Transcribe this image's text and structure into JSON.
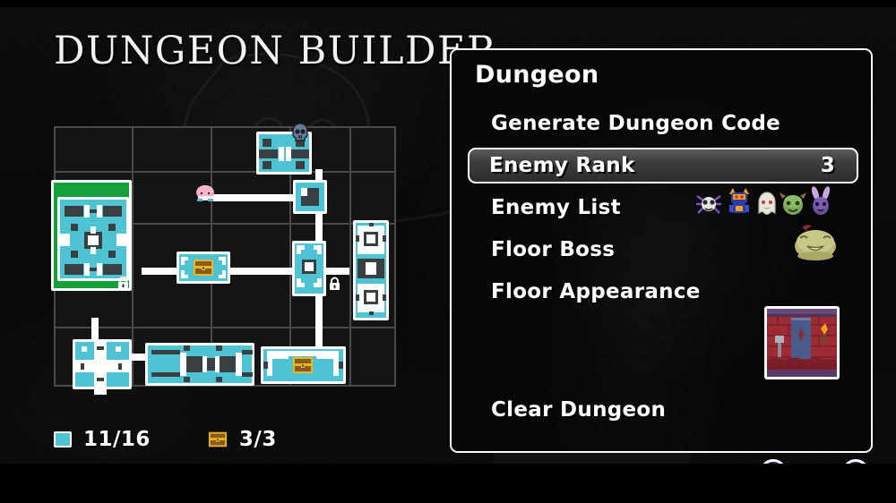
{
  "screen": {
    "title": "DUNGEON BUILDER"
  },
  "map": {
    "columns": 5,
    "rows": 5,
    "status": {
      "rooms_icon": "room-square-icon",
      "rooms_count": "11/16",
      "chest_icon": "treasure-chest-icon",
      "chest_count": "3/3"
    },
    "markers": {
      "boss_icon": "skull-icon",
      "hero_icon": "hero-sprite",
      "lock_icon": "lock-icon"
    }
  },
  "panel": {
    "title": "Dungeon",
    "items": [
      {
        "label": "Generate Dungeon Code",
        "value": "",
        "selected": false
      },
      {
        "label": "Enemy Rank",
        "value": "3",
        "selected": true
      },
      {
        "label": "Enemy List",
        "value": "",
        "selected": false
      },
      {
        "label": "Floor Boss",
        "value": "",
        "selected": false
      },
      {
        "label": "Floor Appearance",
        "value": "",
        "selected": false
      },
      {
        "label": "Clear Dungeon",
        "value": "",
        "selected": false
      }
    ],
    "enemy_list": [
      {
        "name": "spider-enemy-sprite",
        "body": "#d8d8d8",
        "accent": "#8d5fd6"
      },
      {
        "name": "armored-knight-enemy-sprite",
        "body": "#f0a024",
        "accent": "#2a3ea8"
      },
      {
        "name": "ghost-enemy-sprite",
        "body": "#e8e6dc",
        "accent": "#c04040"
      },
      {
        "name": "green-beast-enemy-sprite",
        "body": "#7aa85a",
        "accent": "#a06a3a"
      },
      {
        "name": "bat-enemy-sprite",
        "body": "#6a4f9e",
        "accent": "#c9a6e0"
      }
    ],
    "floor_boss": {
      "name": "slime-boss-sprite",
      "body": "#b8b878",
      "accent": "#8e2a3a"
    },
    "floor_appearance": {
      "name": "red-brick-room-preview",
      "wall": "#9e2b33",
      "banner": "#4a5a8a",
      "trim": "#6a4a7a"
    }
  },
  "colors": {
    "room_fill": "#4ec3d4",
    "room_border": "#ffffff",
    "selected_room": "#14a03a",
    "grid_line": "#4a4a4a",
    "cell_bg": "#141414",
    "panel_border": "#ffffff",
    "text": "#ffffff"
  },
  "prompts": [
    {
      "name": "button-prompt-left"
    },
    {
      "name": "button-prompt-right"
    }
  ]
}
